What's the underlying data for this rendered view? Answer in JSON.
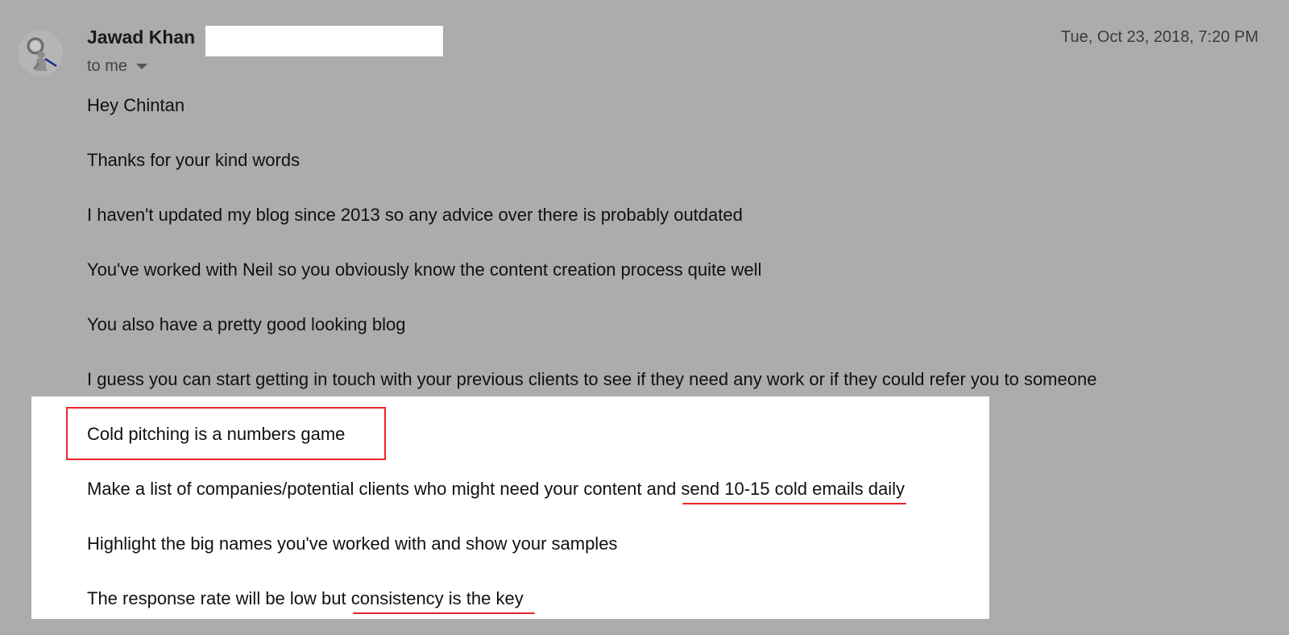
{
  "email": {
    "sender_name": "Jawad Khan",
    "to_line": "to me",
    "date": "Tue, Oct 23, 2018, 7:20 PM"
  },
  "body": {
    "greeting": "Hey Chintan",
    "p1": "Thanks for your kind words",
    "p2": "I haven't updated my blog since 2013 so any advice over there is probably outdated",
    "p3": "You've worked with Neil so you obviously know the content creation process quite well",
    "p4": "You also have a pretty good looking blog",
    "p5": "I guess you can start getting in touch with your previous clients to see if they need any work or if they could refer you to someone",
    "p6": "Cold pitching is a numbers game",
    "p7_start": "Make a list of companies/potential clients who might need your content and ",
    "p7_highlight": "send 10-15 cold emails daily",
    "p8": "Highlight the big names you've worked with and show your samples",
    "p9_start": "The response rate will be low but ",
    "p9_highlight": "consistency is the key"
  },
  "colors": {
    "background": "#acacac",
    "highlight_panel": "#ffffff",
    "annotation_red": "#e8262a"
  },
  "icons": {
    "avatar": "avatar-magnifier-figure",
    "caret": "caret-down-icon"
  }
}
